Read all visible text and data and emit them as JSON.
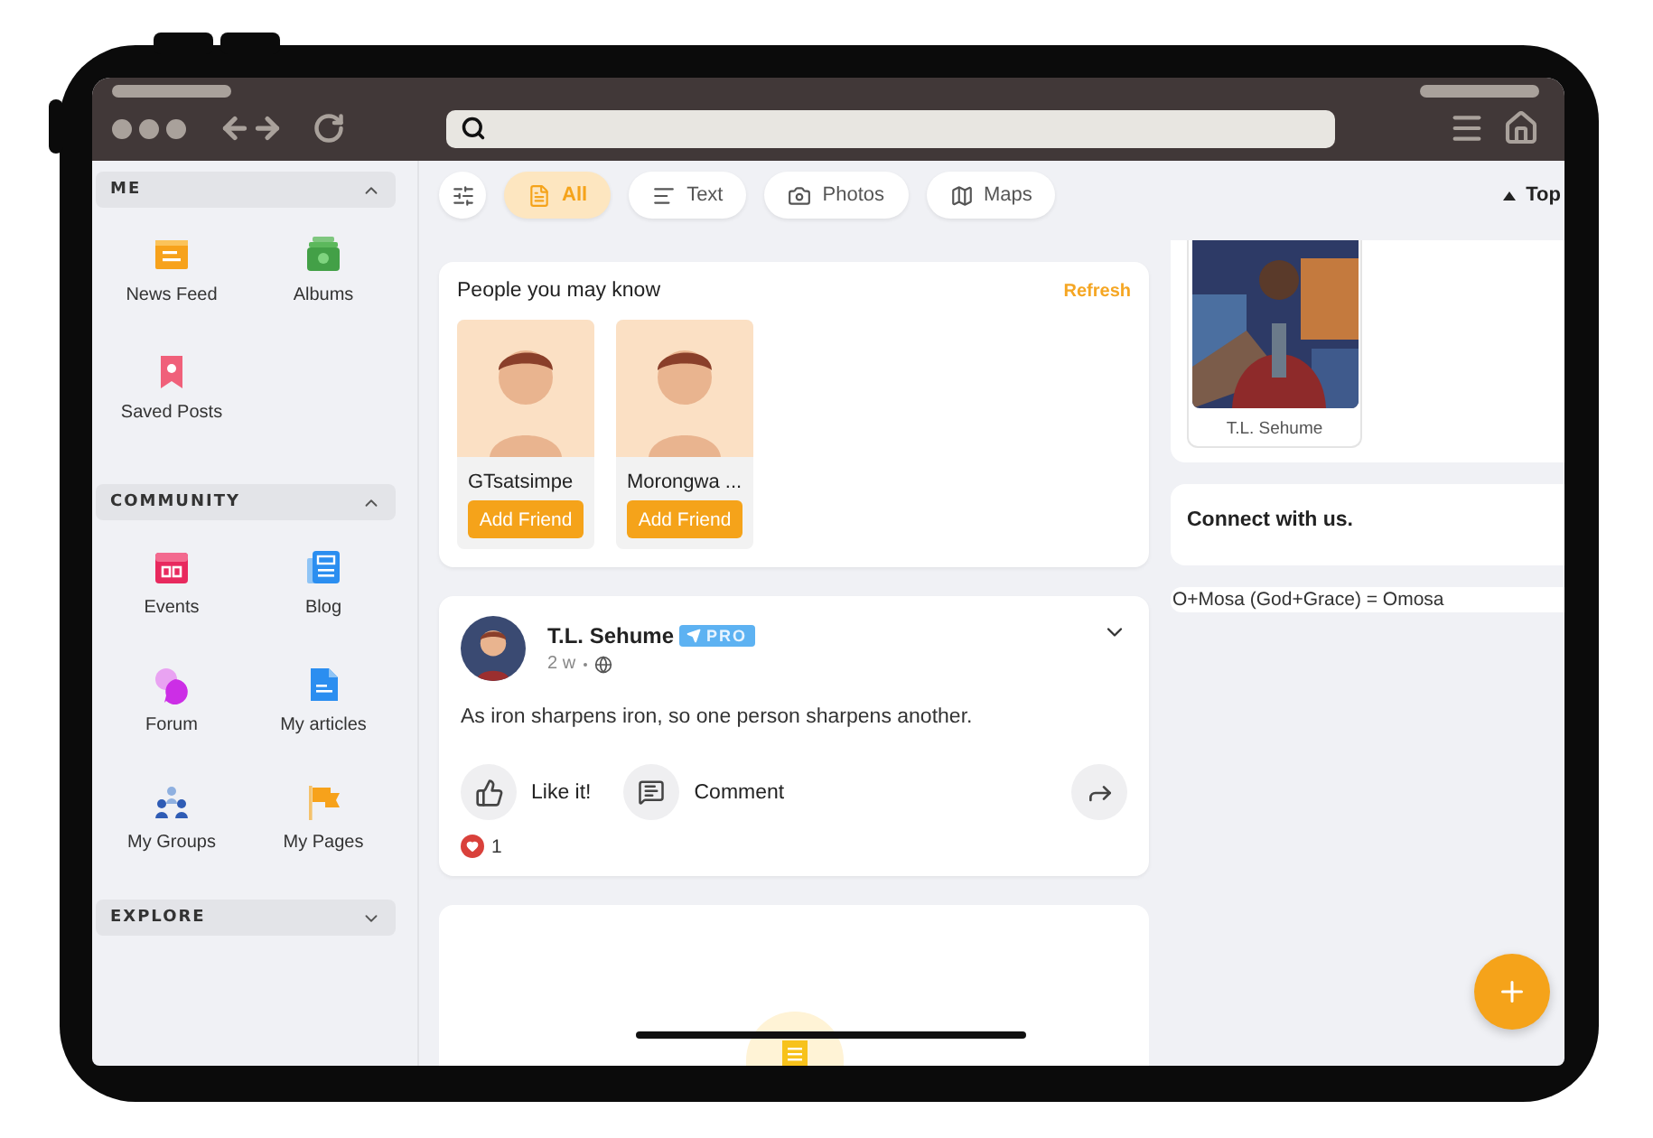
{
  "sidebar": {
    "sections": [
      {
        "title": "ME",
        "expanded": true,
        "items": [
          {
            "label": "News Feed",
            "kind": "feed"
          },
          {
            "label": "Albums",
            "kind": "albums"
          },
          {
            "label": "Saved Posts",
            "kind": "saved"
          }
        ]
      },
      {
        "title": "COMMUNITY",
        "expanded": true,
        "items": [
          {
            "label": "Events",
            "kind": "events"
          },
          {
            "label": "Blog",
            "kind": "blog"
          },
          {
            "label": "Forum",
            "kind": "forum"
          },
          {
            "label": "My articles",
            "kind": "articles"
          },
          {
            "label": "My Groups",
            "kind": "groups"
          },
          {
            "label": "My Pages",
            "kind": "pages"
          }
        ]
      },
      {
        "title": "EXPLORE",
        "expanded": false
      }
    ]
  },
  "filters": [
    {
      "label": "All",
      "kind": "all",
      "selected": true
    },
    {
      "label": "Text",
      "kind": "text",
      "selected": false
    },
    {
      "label": "Photos",
      "kind": "photos",
      "selected": false
    },
    {
      "label": "Maps",
      "kind": "maps",
      "selected": false
    }
  ],
  "top_link": "Top",
  "people_card": {
    "title": "People you may know",
    "action": "Refresh",
    "people": [
      {
        "name": "GTsatsimpe",
        "button": "Add Friend"
      },
      {
        "name": "Morongwa ...",
        "button": "Add Friend"
      }
    ]
  },
  "post": {
    "author": "T.L. Sehume",
    "badge": "PRO",
    "time": "2 w",
    "text": "As iron sharpens iron, so one person sharpens another.",
    "actions": [
      {
        "label": "Like it!",
        "kind": "like"
      },
      {
        "label": "Comment",
        "kind": "comment"
      }
    ],
    "reactions": "1"
  },
  "profile_card": {
    "name": "T.L. Sehume"
  },
  "connect": {
    "title": "Connect with us."
  },
  "tagline": "O+Mosa (God+Grace) = Omosa"
}
